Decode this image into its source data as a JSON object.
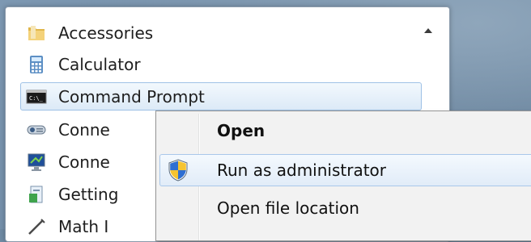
{
  "start_menu": {
    "items": [
      {
        "label": "Accessories",
        "icon": "folder-icon"
      },
      {
        "label": "Calculator",
        "icon": "calculator-icon"
      },
      {
        "label": "Command Prompt",
        "icon": "command-prompt-icon"
      },
      {
        "label": "Conne",
        "icon": "connect-projector-icon"
      },
      {
        "label": "Conne",
        "icon": "remote-desktop-icon"
      },
      {
        "label": "Getting",
        "icon": "getting-started-icon"
      },
      {
        "label": "Math I",
        "icon": "math-input-icon"
      }
    ],
    "selected_label": "Command Prompt"
  },
  "context_menu": {
    "items": [
      {
        "label": "Open",
        "bold": true
      },
      {
        "label": "Run as administrator",
        "icon": "uac-shield-icon",
        "hover": true
      },
      {
        "label": "Open file location"
      }
    ]
  },
  "colors": {
    "selection_border": "#9ec1e6",
    "menu_background": "#f2f2f2",
    "hover_border": "#a9c7ea"
  }
}
